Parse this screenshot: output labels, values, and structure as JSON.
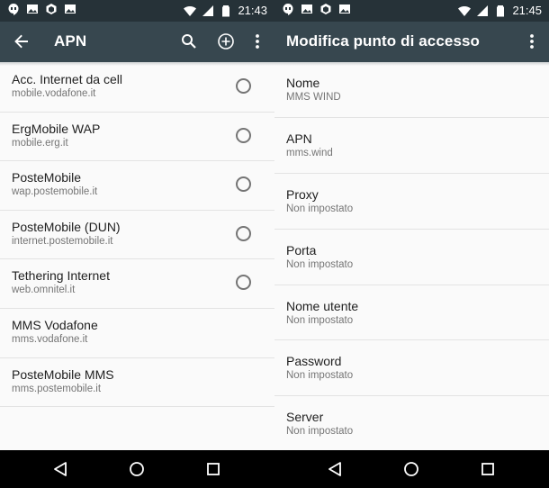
{
  "left_screen": {
    "status_bar": {
      "time": "21:43",
      "icons_left": [
        "hangouts-icon",
        "image-icon",
        "app-cube-icon",
        "image-icon"
      ],
      "icons_right": [
        "wifi-icon",
        "cellular-signal-icon",
        "battery-icon"
      ]
    },
    "app_bar": {
      "title": "APN",
      "back_icon": "arrow-back-icon",
      "actions": [
        "search-icon",
        "add-circle-icon",
        "more-vert-icon"
      ]
    },
    "apn_list": [
      {
        "name": "Acc. Internet da cell",
        "apn": "mobile.vodafone.it",
        "has_radio": true
      },
      {
        "name": "ErgMobile WAP",
        "apn": "mobile.erg.it",
        "has_radio": true
      },
      {
        "name": "PosteMobile",
        "apn": "wap.postemobile.it",
        "has_radio": true
      },
      {
        "name": "PosteMobile (DUN)",
        "apn": "internet.postemobile.it",
        "has_radio": true
      },
      {
        "name": "Tethering Internet",
        "apn": "web.omnitel.it",
        "has_radio": true
      },
      {
        "name": "MMS Vodafone",
        "apn": "mms.vodafone.it",
        "has_radio": false
      },
      {
        "name": "PosteMobile MMS",
        "apn": "mms.postemobile.it",
        "has_radio": false
      }
    ]
  },
  "right_screen": {
    "status_bar": {
      "time": "21:45",
      "icons_left": [
        "hangouts-icon",
        "image-icon",
        "app-cube-icon",
        "image-icon"
      ],
      "icons_right": [
        "wifi-icon",
        "cellular-signal-icon",
        "battery-icon"
      ]
    },
    "app_bar": {
      "title": "Modifica punto di accesso",
      "actions": [
        "more-vert-icon"
      ]
    },
    "fields": [
      {
        "label": "Nome",
        "value": "MMS WIND"
      },
      {
        "label": "APN",
        "value": "mms.wind"
      },
      {
        "label": "Proxy",
        "value": "Non impostato"
      },
      {
        "label": "Porta",
        "value": "Non impostato"
      },
      {
        "label": "Nome utente",
        "value": "Non impostato"
      },
      {
        "label": "Password",
        "value": "Non impostato"
      },
      {
        "label": "Server",
        "value": "Non impostato"
      }
    ]
  },
  "nav_bar": {
    "buttons": [
      "back-triangle-icon",
      "home-circle-icon",
      "recents-square-icon"
    ]
  },
  "colors": {
    "status_bar": "#263238",
    "app_bar": "#37474f",
    "background": "#fafafa",
    "primary_text": "#212121",
    "secondary_text": "#757575"
  }
}
